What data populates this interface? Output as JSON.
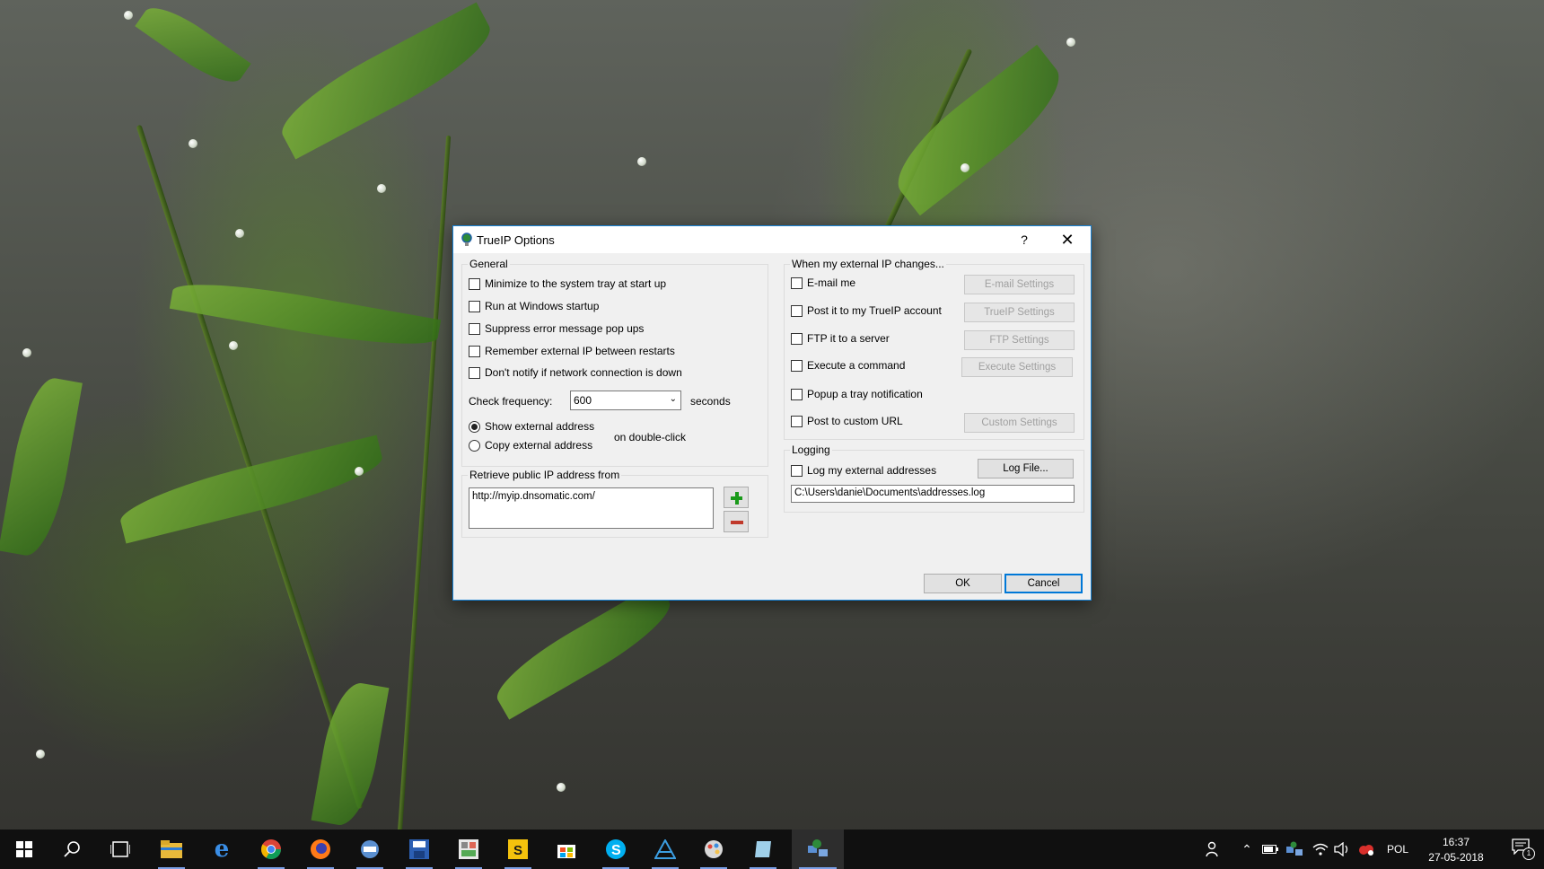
{
  "dialog": {
    "title": "TrueIP Options",
    "help_glyph": "?",
    "close_glyph": "✕",
    "general": {
      "legend": "General",
      "checkboxes": [
        {
          "label": "Minimize to the system tray at start up",
          "checked": false
        },
        {
          "label": "Run at Windows startup",
          "checked": false
        },
        {
          "label": "Suppress error message pop ups",
          "checked": false
        },
        {
          "label": "Remember external IP between restarts",
          "checked": false
        },
        {
          "label": "Don't notify if network connection is down",
          "checked": false
        }
      ],
      "check_frequency_label": "Check frequency:",
      "check_frequency_value": "600",
      "seconds_label": "seconds",
      "radios": [
        {
          "label": "Show external address",
          "selected": true
        },
        {
          "label": "Copy external address",
          "selected": false
        }
      ],
      "double_click_label": "on double-click"
    },
    "retrieve": {
      "legend": "Retrieve public IP address from",
      "urls": "http://myip.dnsomatic.com/",
      "add_icon": "plus-icon",
      "remove_icon": "minus-icon"
    },
    "changes": {
      "legend": "When my external IP changes...",
      "items": [
        {
          "label": "E-mail me",
          "button": "E-mail Settings"
        },
        {
          "label": "Post it to my TrueIP account",
          "button": "TrueIP Settings"
        },
        {
          "label": "FTP it to a server",
          "button": "FTP Settings"
        },
        {
          "label": "Execute a command",
          "button": "Execute Settings"
        },
        {
          "label": "Popup a tray notification",
          "button": ""
        },
        {
          "label": "Post to custom URL",
          "button": "Custom Settings"
        }
      ]
    },
    "logging": {
      "legend": "Logging",
      "log_label": "Log my external addresses",
      "log_file_button": "Log File...",
      "log_path": "C:\\Users\\danie\\Documents\\addresses.log"
    },
    "ok_label": "OK",
    "cancel_label": "Cancel"
  },
  "taskbar": {
    "language": "POL",
    "time": "16:37",
    "date": "27-05-2018",
    "notification_count": "1",
    "apps": [
      "start-icon",
      "search-icon",
      "task-view-icon",
      "file-explorer-icon",
      "edge-icon",
      "chrome-icon",
      "firefox-icon",
      "app-icon",
      "save-app-icon",
      "app-icon-2",
      "app-icon-3",
      "store-icon",
      "skype-icon",
      "app-icon-4",
      "app-icon-5",
      "app-icon-6",
      "trueip-icon"
    ],
    "accent_color": "#7a9fe6"
  }
}
